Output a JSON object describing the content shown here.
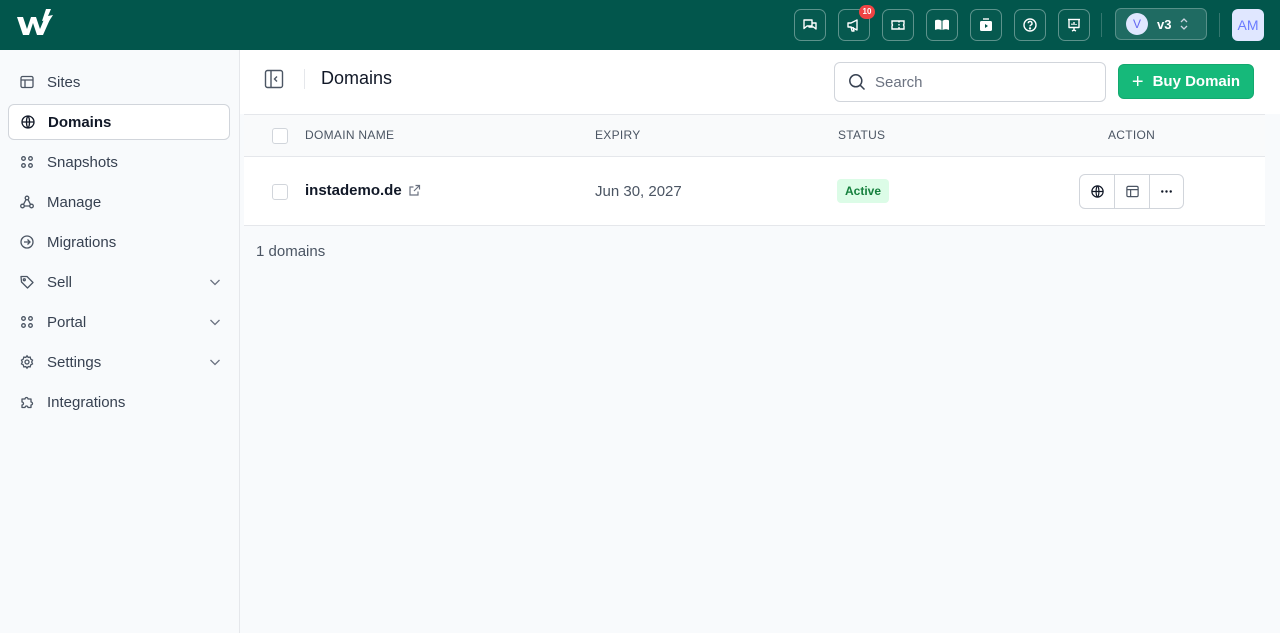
{
  "topbar": {
    "notifications_count": "10",
    "version": {
      "avatar_letter": "V",
      "label": "v3"
    },
    "user_initials": "AM",
    "icons": [
      "chat-icon",
      "megaphone-icon",
      "ticket-icon",
      "book-icon",
      "video-icon",
      "help-icon",
      "presentation-icon"
    ]
  },
  "sidebar": {
    "items": [
      {
        "label": "Sites",
        "icon": "layout-icon"
      },
      {
        "label": "Domains",
        "icon": "globe-icon",
        "active": true
      },
      {
        "label": "Snapshots",
        "icon": "grid-icon"
      },
      {
        "label": "Manage",
        "icon": "network-icon"
      },
      {
        "label": "Migrations",
        "icon": "arrow-circle-icon"
      },
      {
        "label": "Sell",
        "icon": "tag-icon",
        "expandable": true
      },
      {
        "label": "Portal",
        "icon": "grid-icon",
        "expandable": true
      },
      {
        "label": "Settings",
        "icon": "gear-icon",
        "expandable": true
      },
      {
        "label": "Integrations",
        "icon": "puzzle-icon"
      }
    ]
  },
  "header": {
    "title": "Domains",
    "search_placeholder": "Search",
    "buy_label": "Buy Domain"
  },
  "table": {
    "columns": [
      "DOMAIN NAME",
      "EXPIRY",
      "STATUS",
      "ACTION"
    ],
    "rows": [
      {
        "domain": "instademo.de",
        "expiry": "Jun 30, 2027",
        "status": "Active"
      }
    ]
  },
  "footer": {
    "count_label": "1 domains"
  },
  "colors": {
    "topbar": "#02564c",
    "accent": "#16b97a",
    "status_active_bg": "#dcfce7",
    "status_active_text": "#15803d"
  }
}
